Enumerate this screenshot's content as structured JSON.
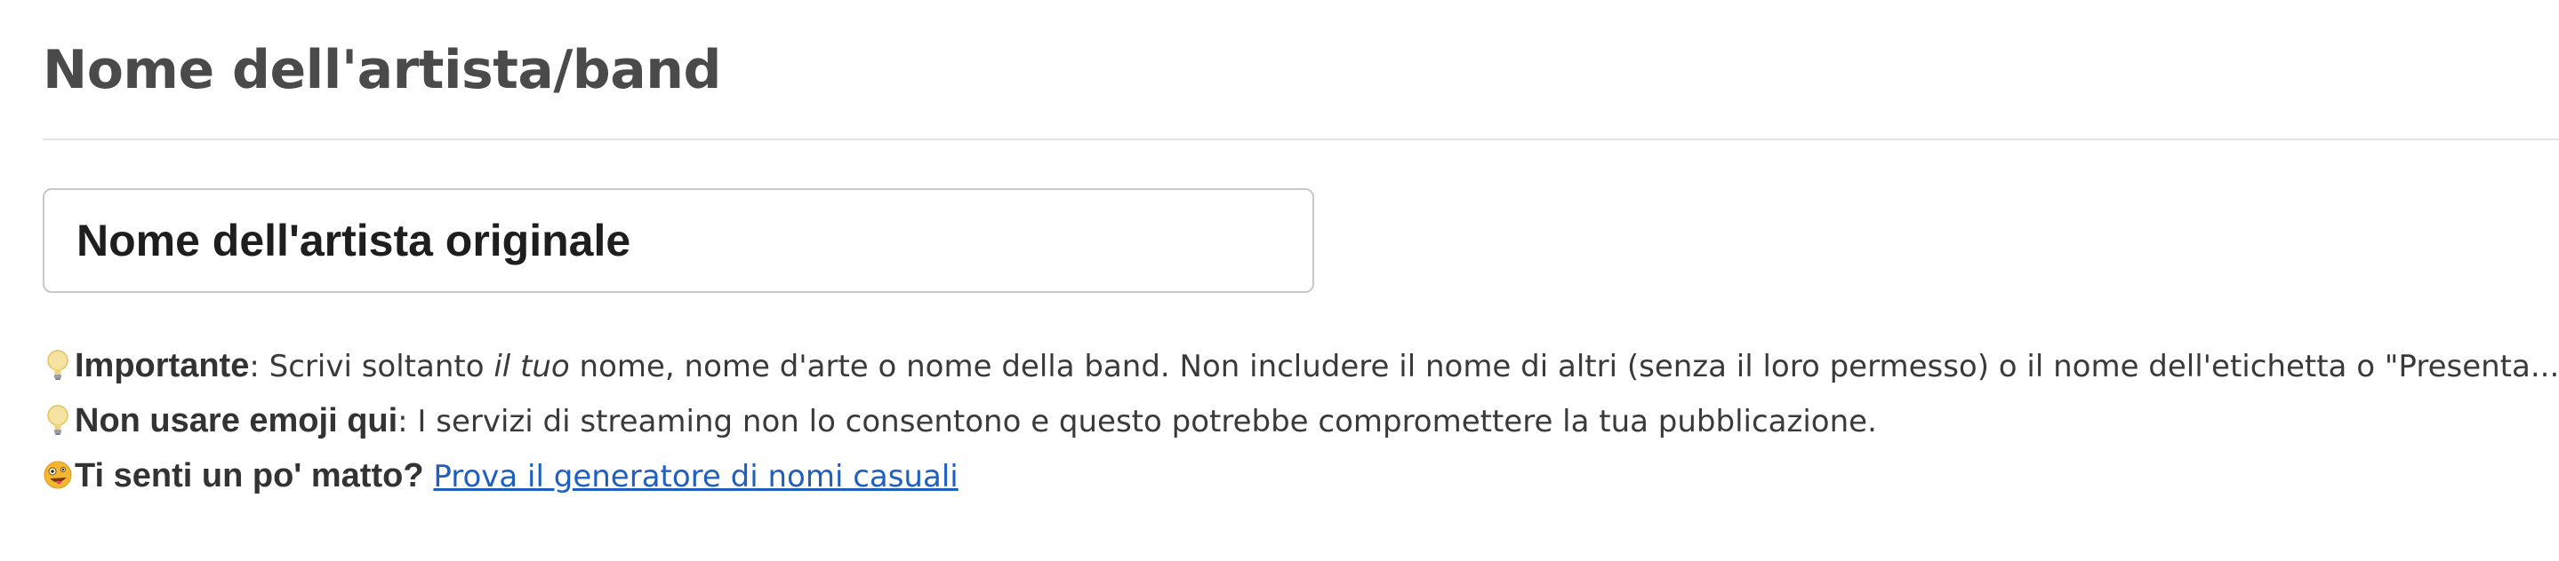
{
  "section": {
    "title": "Nome dell'artista/band"
  },
  "artist_input": {
    "value": "Nome dell'artista originale"
  },
  "hints": [
    {
      "icon": "lightbulb-icon",
      "strong": "Importante",
      "text_before": ": Scrivi soltanto ",
      "emphasis": "il tuo",
      "text_after": " nome, nome d'arte o nome della band. Non includere il nome di altri (senza il loro permesso) o il nome dell'etichetta o \"Presenta...\", ecc."
    },
    {
      "icon": "lightbulb-icon",
      "strong": "Non usare emoji qui",
      "text": ": I servizi di streaming non lo consentono e questo potrebbe compromettere la tua pubblicazione."
    },
    {
      "icon": "zany-face-icon",
      "strong": "Ti senti un po' matto?",
      "link": "Prova il generatore di nomi casuali"
    }
  ],
  "colors": {
    "title": "#4a4a4a",
    "link": "#1f5fbf",
    "input_border": "#c8c8c8",
    "divider": "#e3e3e3"
  }
}
